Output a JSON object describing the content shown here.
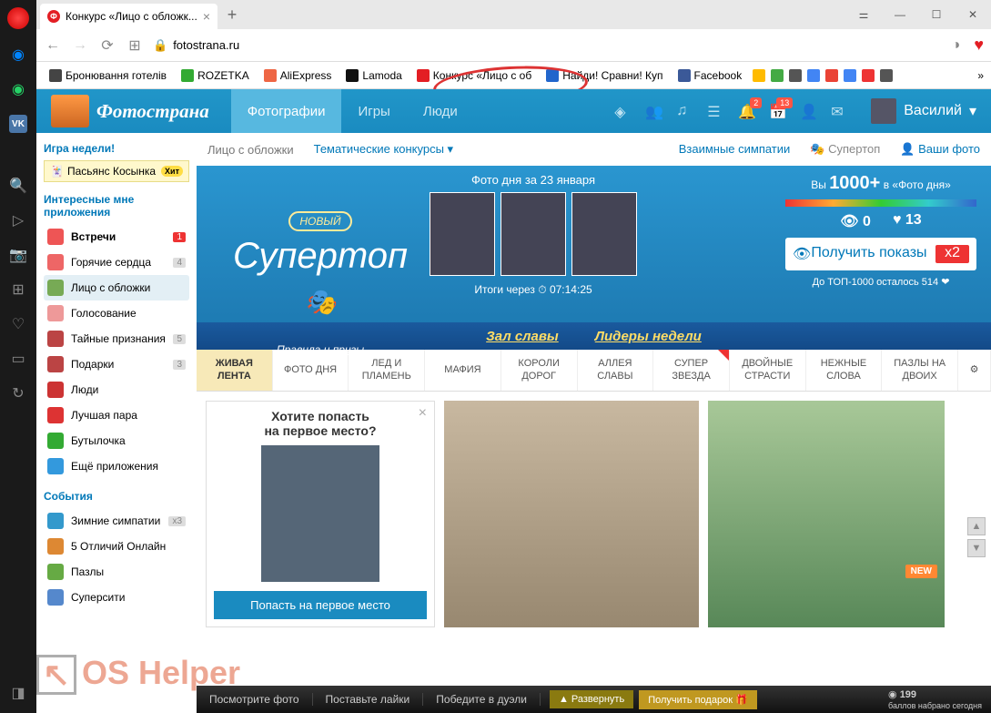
{
  "browser": {
    "tab_title": "Конкурс «Лицо с обложк...",
    "url": "fotostrana.ru",
    "bookmarks": [
      {
        "label": "Бронювання готелів",
        "color": "#444"
      },
      {
        "label": "ROZETKA",
        "color": "#3a3"
      },
      {
        "label": "AliExpress",
        "color": "#e64"
      },
      {
        "label": "Lamoda",
        "color": "#111"
      },
      {
        "label": "Конкурс «Лицо с об",
        "color": "#e31e24"
      },
      {
        "label": "Найди! Сравни! Куп",
        "color": "#2266cc"
      },
      {
        "label": "Facebook",
        "color": "#3b5998"
      }
    ]
  },
  "header": {
    "site_name": "Фотострана",
    "nav": [
      {
        "label": "Фотографии",
        "active": true
      },
      {
        "label": "Игры",
        "active": false
      },
      {
        "label": "Люди",
        "active": false
      }
    ],
    "badges": {
      "bell": "2",
      "cal": "13"
    },
    "user_name": "Василий"
  },
  "sidebar": {
    "game_week_title": "Игра недели!",
    "game_name": "Пасьянс Косынка",
    "hit": "Хит",
    "apps_title": "Интересные мне приложения",
    "apps": [
      {
        "label": "Встречи",
        "count": "1",
        "red": true,
        "bold": true,
        "color": "#e55"
      },
      {
        "label": "Горячие сердца",
        "count": "4",
        "color": "#e66"
      },
      {
        "label": "Лицо с обложки",
        "sel": true,
        "color": "#7a5"
      },
      {
        "label": "Голосование",
        "color": "#e99"
      },
      {
        "label": "Тайные признания",
        "count": "5",
        "color": "#b44"
      },
      {
        "label": "Подарки",
        "count": "3",
        "color": "#b44"
      },
      {
        "label": "Люди",
        "color": "#c33"
      },
      {
        "label": "Лучшая пара",
        "color": "#d33"
      },
      {
        "label": "Бутылочка",
        "color": "#3a3"
      },
      {
        "label": "Ещё приложения",
        "color": "#39d"
      }
    ],
    "events_title": "События",
    "events": [
      {
        "label": "Зимние симпатии",
        "count": "x3",
        "color": "#39c"
      },
      {
        "label": "5 Отличий Онлайн",
        "color": "#d83"
      },
      {
        "label": "Пазлы",
        "color": "#6a4"
      },
      {
        "label": "Суперсити",
        "color": "#58c"
      }
    ]
  },
  "subnav": {
    "left": [
      "Лицо с обложки",
      "Тематические конкурсы ▾"
    ],
    "right": [
      "Взаимные симпатии",
      "Супертоп",
      "Ваши фото"
    ],
    "user_icon": "👤"
  },
  "banner": {
    "new_label": "НОВЫЙ",
    "title": "Супертоп",
    "rules": "Правила и призы",
    "photo_day": "Фото дня за 23 января",
    "timer_label": "Итоги через",
    "timer": "07:14:25",
    "you_in": "Вы",
    "count": "1000+",
    "in_photo": "в «Фото дня»",
    "views": "0",
    "likes": "13",
    "get_btn": "Получить показы",
    "mult": "x2",
    "top1000": "До ТОП-1000 осталось 514 ❤"
  },
  "ribbon": {
    "hall": "Зал славы",
    "leaders": "Лидеры недели"
  },
  "tabs": [
    {
      "l1": "ЖИВАЯ",
      "l2": "ЛЕНТА",
      "active": true
    },
    {
      "l1": "ФОТО ДНЯ"
    },
    {
      "l1": "ЛЕД И",
      "l2": "ПЛАМЕНЬ"
    },
    {
      "l1": "МАФИЯ"
    },
    {
      "l1": "КОРОЛИ",
      "l2": "ДОРОГ"
    },
    {
      "l1": "АЛЛЕЯ",
      "l2": "СЛАВЫ"
    },
    {
      "l1": "СУПЕР",
      "l2": "ЗВЕЗДА",
      "red": true
    },
    {
      "l1": "ДВОЙНЫЕ",
      "l2": "СТРАСТИ"
    },
    {
      "l1": "НЕЖНЫЕ",
      "l2": "СЛОВА"
    },
    {
      "l1": "ПАЗЛЫ НА",
      "l2": "ДВОИХ"
    }
  ],
  "promo": {
    "heading": "Хотите попасть\nна первое место?",
    "btn": "Попасть на первое место",
    "new": "NEW"
  },
  "bottombar": {
    "items": [
      "Посмотрите фото",
      "Поставьте лайки",
      "Победите в дуэли"
    ],
    "expand": "▲ Развернуть",
    "gift": "Получить подарок 🎁",
    "score": "199",
    "score_label": "баллов набрано сегодня"
  },
  "watermark": "OS Helper"
}
